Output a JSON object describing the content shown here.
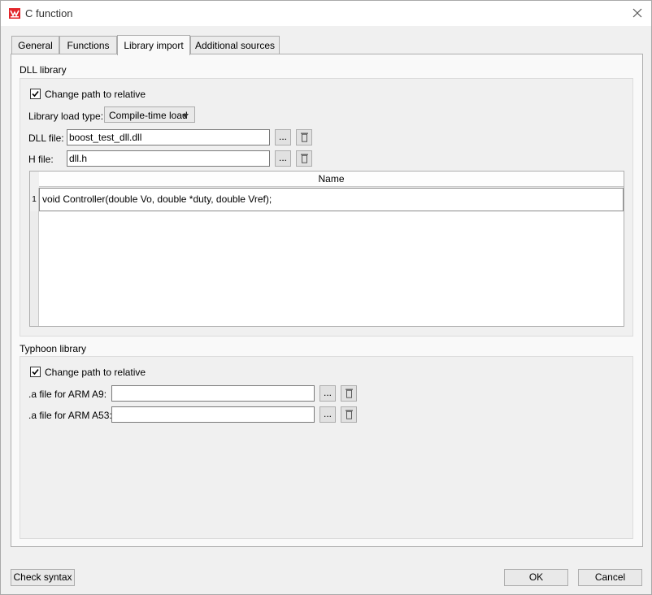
{
  "window": {
    "title": "C function"
  },
  "tabs": [
    {
      "label": "General"
    },
    {
      "label": "Functions"
    },
    {
      "label": "Library import"
    },
    {
      "label": "Additional sources"
    }
  ],
  "dll": {
    "section_label": "DLL library",
    "change_path_label": "Change path to relative",
    "change_path_checked": true,
    "load_type_label": "Library load type:",
    "load_type_value": "Compile-time load",
    "dll_file_label": "DLL file:",
    "dll_file_value": "boost_test_dll.dll",
    "h_file_label": "H file:",
    "h_file_value": "dll.h",
    "browse_label": "...",
    "table": {
      "column_header": "Name",
      "rows": [
        {
          "num": "1",
          "name": "void Controller(double Vo, double *duty, double Vref);"
        }
      ]
    }
  },
  "typhoon": {
    "section_label": "Typhoon library",
    "change_path_label": "Change path to relative",
    "change_path_checked": true,
    "arm_a9_label": ".a file for ARM A9:",
    "arm_a9_value": "",
    "arm_a53_label": ".a file for ARM A53:",
    "arm_a53_value": "",
    "browse_label": "..."
  },
  "footer": {
    "check_syntax_label": "Check syntax",
    "ok_label": "OK",
    "cancel_label": "Cancel"
  },
  "colors": {
    "accent": "#e3262b"
  }
}
